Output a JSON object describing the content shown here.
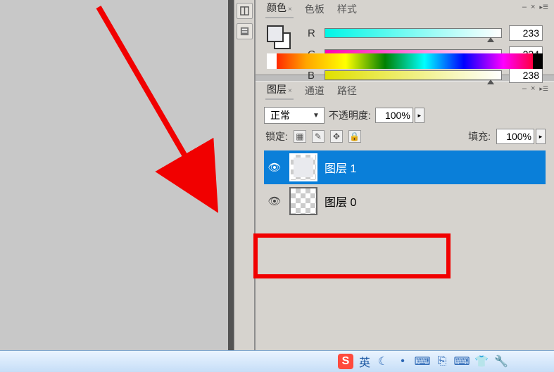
{
  "color_panel": {
    "tabs": {
      "color": "颜色",
      "swatch": "色板",
      "style": "样式"
    },
    "channels": {
      "r": {
        "label": "R",
        "value": "233"
      },
      "g": {
        "label": "G",
        "value": "234"
      },
      "b": {
        "label": "B",
        "value": "238"
      }
    }
  },
  "layers_panel": {
    "tabs": {
      "layers": "图层",
      "channels": "通道",
      "paths": "路径"
    },
    "blend_mode": "正常",
    "opacity": {
      "label": "不透明度:",
      "value": "100%"
    },
    "lock_label": "锁定:",
    "fill": {
      "label": "填充:",
      "value": "100%"
    },
    "items": [
      {
        "name": "图层 1",
        "selected": true,
        "fill_thumb": true
      },
      {
        "name": "图层 0",
        "selected": false,
        "fill_thumb": false
      }
    ]
  },
  "ime": {
    "logo": "S",
    "lang": "英"
  }
}
